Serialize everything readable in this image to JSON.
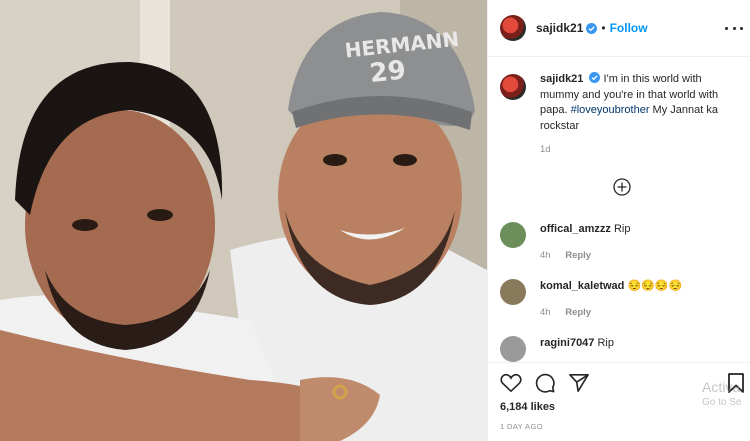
{
  "post": {
    "username": "sajidk21",
    "follow_label": "Follow",
    "dot": "•",
    "caption": {
      "username": "sajidk21",
      "text": "I'm in this world with mummy and you're in that world with papa. ",
      "hashtag": "#loveyoubrother",
      "text_after": " My Jannat ka rockstar",
      "time": "1d"
    },
    "comments": [
      {
        "username": "offical_amzzz",
        "text": "Rip",
        "time": "4h",
        "reply": "Reply",
        "avatar_color": "#6b8e5a"
      },
      {
        "username": "komal_kaletwad",
        "text": "😔😔😔😔",
        "time": "4h",
        "reply": "Reply",
        "avatar_color": "#8a7a5c"
      },
      {
        "username": "ragini7047",
        "text": "Rip",
        "time": "",
        "reply": "",
        "avatar_color": "#9a9a9a"
      }
    ],
    "likes": "6,184 likes",
    "posted_ago": "1 DAY AGO"
  },
  "watermark": {
    "line1": "Activa",
    "line2": "Go to Se"
  },
  "icons": {
    "verified": "verified-badge-icon",
    "more": "more-options-icon",
    "load_more": "add-circle-icon",
    "like": "heart-icon",
    "comment": "comment-icon",
    "share": "send-icon",
    "save": "bookmark-icon"
  },
  "colors": {
    "link_blue": "#0095f6",
    "hashtag": "#00376b",
    "muted": "#8e8e8e"
  }
}
